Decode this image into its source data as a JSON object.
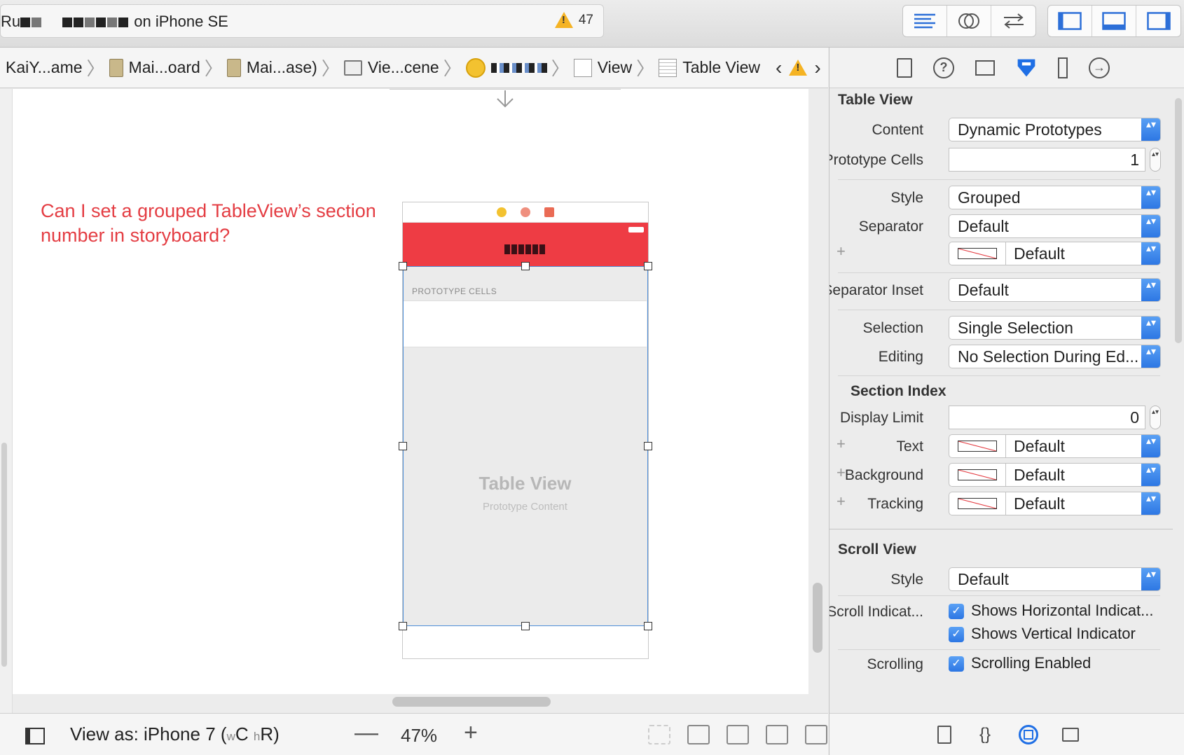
{
  "toolbar": {
    "scheme_status_prefix": "Ru",
    "scheme_status_suffix": "on iPhone SE",
    "warning_count": "47",
    "editor_buttons": [
      "standard-editor-icon",
      "assistant-editor-icon",
      "version-editor-icon"
    ],
    "panel_buttons": [
      "navigator-panel-icon",
      "debug-area-icon",
      "utilities-panel-icon"
    ]
  },
  "jumpbar": {
    "crumbs": [
      "KaiY...ame",
      "Mai...oard",
      "Mai...ase)",
      "Vie...cene",
      "View",
      "Table View"
    ]
  },
  "canvas": {
    "question": "Can I set a grouped TableView’s section number in storyboard?",
    "section_header": "PROTOTYPE CELLS",
    "tableview_title": "Table View",
    "tableview_subtitle": "Prototype Content"
  },
  "bottombar": {
    "view_as": "View as: iPhone 7",
    "size_class_open": "(",
    "size_w": "w",
    "size_C": "C",
    "size_h": "h",
    "size_R": "R",
    "size_class_close": ")",
    "zoom_minus": "—",
    "zoom": "47%",
    "zoom_plus": "+"
  },
  "inspector": {
    "table_view_section": "Table View",
    "content_label": "Content",
    "content_value": "Dynamic Prototypes",
    "prototype_cells_label": "Prototype Cells",
    "prototype_cells_value": "1",
    "style_label": "Style",
    "style_value": "Grouped",
    "separator_label": "Separator",
    "separator_value": "Default",
    "separator_color_value": "Default",
    "separator_inset_label": "Separator Inset",
    "separator_inset_value": "Default",
    "selection_label": "Selection",
    "selection_value": "Single Selection",
    "editing_label": "Editing",
    "editing_value": "No Selection During Ed...",
    "section_index_title": "Section Index",
    "display_limit_label": "Display Limit",
    "display_limit_value": "0",
    "text_label": "Text",
    "text_value": "Default",
    "background_label": "Background",
    "background_value": "Default",
    "tracking_label": "Tracking",
    "tracking_value": "Default",
    "scroll_view_section": "Scroll View",
    "scroll_style_label": "Style",
    "scroll_style_value": "Default",
    "scroll_indicators_label": "Scroll Indicat...",
    "shows_horizontal": "Shows Horizontal Indicat...",
    "shows_vertical": "Shows Vertical Indicator",
    "scrolling_label": "Scrolling",
    "scrolling_enabled": "Scrolling Enabled",
    "plus": "+",
    "check": "✓",
    "popup_arrows": "▴▾",
    "stepper_arrows": "▴▾"
  },
  "colors": {
    "accent": "#2c76e3",
    "navbar": "#ee3c44",
    "question_text": "#e43d43",
    "warning": "#f5b323"
  }
}
